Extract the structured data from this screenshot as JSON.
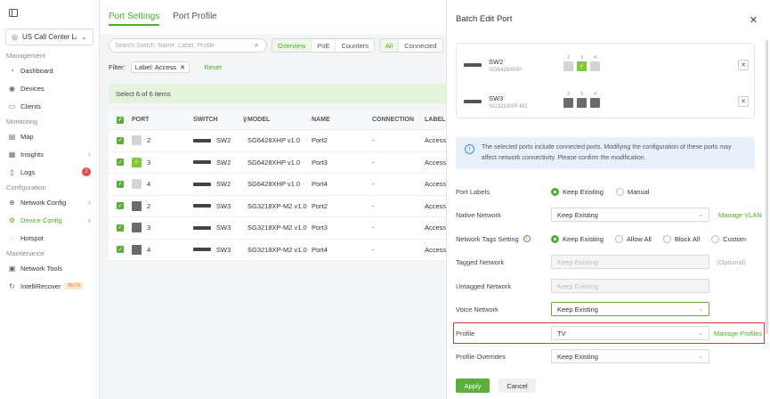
{
  "sidebar": {
    "site_name": "US Call Center La...",
    "sections": {
      "management": "Management",
      "monitoring": "Monitoring",
      "configuration": "Configuration",
      "maintenance": "Maintenance"
    },
    "items": {
      "dashboard": "Dashboard",
      "devices": "Devices",
      "clients": "Clients",
      "map": "Map",
      "insights": "Insights",
      "logs": "Logs",
      "logs_badge": "2",
      "network_config": "Network Config",
      "device_config": "Device Config",
      "hotspot": "Hotspot",
      "network_tools": "Network Tools",
      "intellirecover": "IntelliRecover",
      "beta": "BETA"
    }
  },
  "main": {
    "tabs": [
      "Port Settings",
      "Port Profile"
    ],
    "search_placeholder": "Search Switch, Name, Label, Profile",
    "view_seg": [
      "Overview",
      "PoE",
      "Counters"
    ],
    "status_seg": [
      "All",
      "Connected"
    ],
    "filter_label": "Filter:",
    "filter_chip": "Label: Access",
    "reset": "Reset",
    "selection": "Select 6 of 6 items",
    "columns": [
      "PORT",
      "SWITCH",
      "MODEL",
      "NAME",
      "CONNECTION",
      "LABEL"
    ],
    "rows": [
      {
        "port": "2",
        "switch": "SW2",
        "model": "SG6428XHP v1.0",
        "name": "Port2",
        "conn": "-",
        "label": "Access"
      },
      {
        "port": "3",
        "switch": "SW2",
        "model": "SG6428XHP v1.0",
        "name": "Port3",
        "conn": "-",
        "label": "Access"
      },
      {
        "port": "4",
        "switch": "SW2",
        "model": "SG6428XHP v1.0",
        "name": "Port4",
        "conn": "-",
        "label": "Access"
      },
      {
        "port": "2",
        "switch": "SW3",
        "model": "SG3218XP-M2 v1.0",
        "name": "Port2",
        "conn": "-",
        "label": "Access"
      },
      {
        "port": "3",
        "switch": "SW3",
        "model": "SG3218XP-M2 v1.0",
        "name": "Port3",
        "conn": "-",
        "label": "Access"
      },
      {
        "port": "4",
        "switch": "SW3",
        "model": "SG3218XP-M2 v1.0",
        "name": "Port4",
        "conn": "-",
        "label": "Access"
      }
    ]
  },
  "drawer": {
    "title": "Batch Edit Port",
    "devices": [
      {
        "name": "SW2",
        "model": "SG6428XHP",
        "ports": [
          "2",
          "3",
          "4"
        ]
      },
      {
        "name": "SW3",
        "model": "SG3218XP-M2",
        "ports": [
          "2",
          "3",
          "4"
        ]
      }
    ],
    "info": "The selected ports include connected ports. Modifying the configuration of these ports may affect network connectivity. Please confirm the modification.",
    "port_labels": {
      "label": "Port Labels",
      "opt1": "Keep Existing",
      "opt2": "Manual"
    },
    "native_network": {
      "label": "Native Network",
      "value": "Keep Existing",
      "link": "Manage VLAN"
    },
    "network_tags": {
      "label": "Network Tags Setting",
      "opt1": "Keep Existing",
      "opt2": "Allow All",
      "opt3": "Block All",
      "opt4": "Custom"
    },
    "tagged_network": {
      "label": "Tagged Network",
      "placeholder": "Keep Existing",
      "hint": "(Optional)"
    },
    "untagged_network": {
      "label": "Untagged Network",
      "placeholder": "Keep Existing"
    },
    "voice_network": {
      "label": "Voice Network",
      "value": "Keep Existing"
    },
    "profile": {
      "label": "Profile",
      "value": "TV",
      "link": "Manage Profiles"
    },
    "profile_overrides": {
      "label": "Profile Overrides",
      "value": "Keep Existing"
    },
    "apply": "Apply",
    "cancel": "Cancel"
  }
}
